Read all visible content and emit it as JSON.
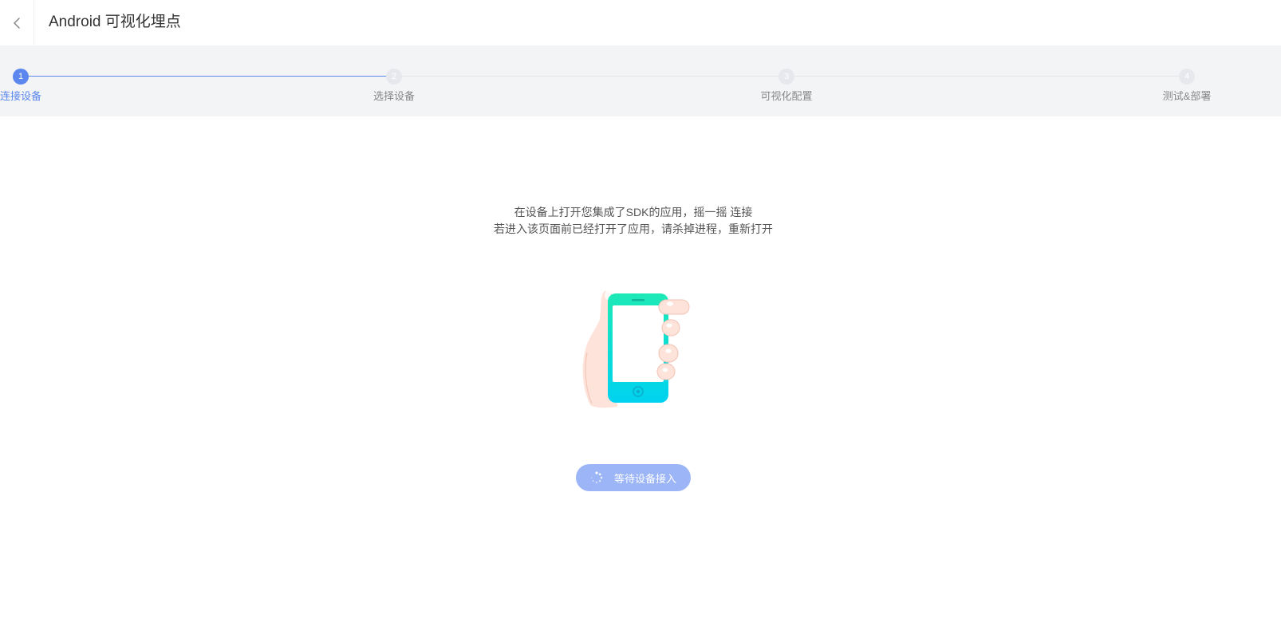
{
  "header": {
    "back_icon": "chevron-left-icon",
    "title": "Android 可视化埋点"
  },
  "steps": {
    "active_index": 0,
    "items": [
      {
        "number": "1",
        "label": "连接设备"
      },
      {
        "number": "2",
        "label": "选择设备"
      },
      {
        "number": "3",
        "label": "可视化配置"
      },
      {
        "number": "4",
        "label": "测试&部署"
      }
    ],
    "colors": {
      "active": "#5c87ee",
      "idle": "#e6e8ed"
    }
  },
  "main": {
    "instruction_line1": "在设备上打开您集成了SDK的应用，摇一摇 连接",
    "instruction_line2": "若进入该页面前已经打开了应用，请杀掉进程，重新打开",
    "illustration": "hand-holding-phone",
    "wait_button": {
      "label": "等待设备接入",
      "icon": "loading-spinner-icon",
      "color": "#9bb5f6"
    }
  }
}
